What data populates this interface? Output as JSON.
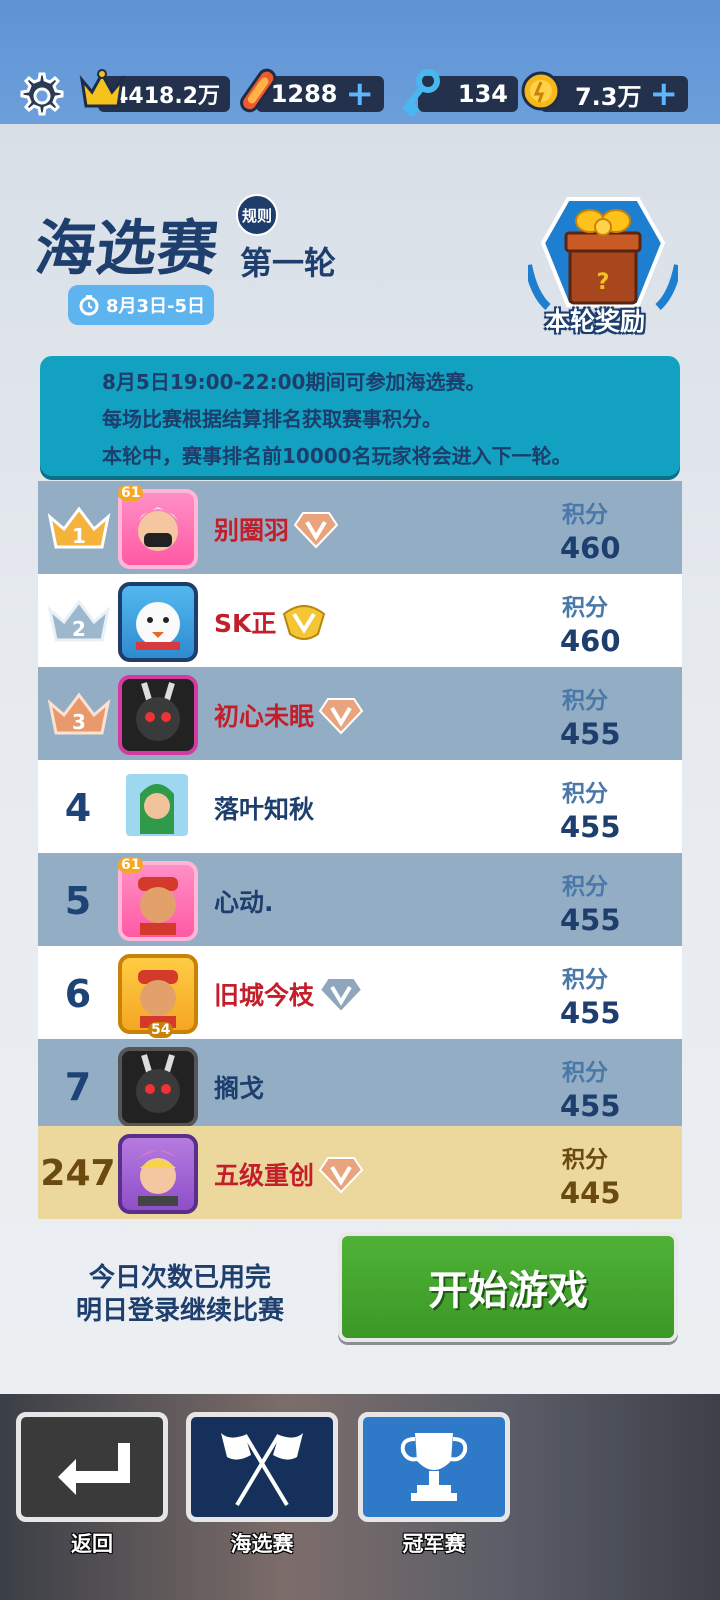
{
  "top_bar": {
    "trophies": "4418.2万",
    "boards": "1288",
    "keys": "134",
    "coins": "7.3万",
    "plus": "+"
  },
  "header": {
    "title": "海选赛",
    "rules": "规则",
    "round": "第一轮",
    "date_range": "8月3日-5日",
    "reward_label": "本轮奖励"
  },
  "info": {
    "lines": [
      "8月5日19:00-22:00期间可参加海选赛。",
      "每场比赛根据结算排名获取赛事积分。",
      "本轮中，赛事排名前10000名玩家将会进入下一轮。"
    ]
  },
  "leaderboard": {
    "score_label": "积分",
    "rows": [
      {
        "rank": "1",
        "name": "别圈羽",
        "score": "460"
      },
      {
        "rank": "2",
        "name": "SK正",
        "score": "460"
      },
      {
        "rank": "3",
        "name": "初心未眠",
        "score": "455"
      },
      {
        "rank": "4",
        "name": "落叶知秋",
        "score": "455"
      },
      {
        "rank": "5",
        "name": "心动.",
        "score": "455"
      },
      {
        "rank": "6",
        "name": "旧城今枝",
        "score": "455"
      },
      {
        "rank": "7",
        "name": "搁戈",
        "score": "455"
      }
    ],
    "me": {
      "rank": "247",
      "name": "五级重创",
      "score": "445"
    }
  },
  "status": {
    "line1": "今日次数已用完",
    "line2": "明日登录继续比赛"
  },
  "start_button": "开始游戏",
  "nav": {
    "back": "返回",
    "qualifier": "海选赛",
    "champion": "冠军赛"
  },
  "avatar_badges": {
    "a": "61",
    "b": "54"
  },
  "colors": {
    "accent_blue": "#1e3f6e",
    "info_teal": "#12a1c0",
    "start_green": "#4fb236",
    "name_red": "#c31f2b",
    "row_dark": "#93adc5",
    "my_row": "#ecd89d"
  }
}
